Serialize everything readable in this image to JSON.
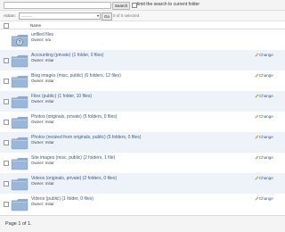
{
  "search": {
    "button_label": "Search",
    "limit_label": "limit the search to current folder",
    "query": ""
  },
  "action": {
    "label": "Action:",
    "selected_value": "---------",
    "go_label": "Go",
    "selected_count": "0 of 0 selected"
  },
  "table": {
    "header_name": "Name",
    "rows": [
      {
        "title": "unfiled files",
        "owner": "Owner: n/a",
        "change": "",
        "icon": "unknown-folder-icon"
      },
      {
        "title": "Accounting (private) (1 folder, 0 files)",
        "owner": "Owner: mitar",
        "change": "Change",
        "icon": "folder-icon"
      },
      {
        "title": "Blog images (misc, public) (6 folders, 12 files)",
        "owner": "Owner: mitar",
        "change": "Change",
        "icon": "folder-icon"
      },
      {
        "title": "Files (public) (1 folder, 10 files)",
        "owner": "Owner: mitar",
        "change": "Change",
        "icon": "folder-icon"
      },
      {
        "title": "Photos (originals, private) (5 folders, 0 files)",
        "owner": "Owner: mitar",
        "change": "Change",
        "icon": "folder-icon"
      },
      {
        "title": "Photos (resized from originals, public) (5 folders, 0 files)",
        "owner": "Owner: mitar",
        "change": "Change",
        "icon": "folder-icon"
      },
      {
        "title": "Site images (misc, public) (2 folders, 1 file)",
        "owner": "Owner: mitar",
        "change": "Change",
        "icon": "folder-icon"
      },
      {
        "title": "Videos (originals, private) (2 folders, 0 files)",
        "owner": "Owner: mitar",
        "change": "Change",
        "icon": "folder-icon"
      },
      {
        "title": "Videos (public) (1 folder, 0 files)",
        "owner": "Owner: mitar",
        "change": "Change",
        "icon": "folder-icon"
      }
    ]
  },
  "footer": {
    "page_text": "Page 1 of 1."
  },
  "colors": {
    "link": "#3c5b8c",
    "row_alt": "#eef3fa",
    "folder": "#9bb6d8"
  }
}
